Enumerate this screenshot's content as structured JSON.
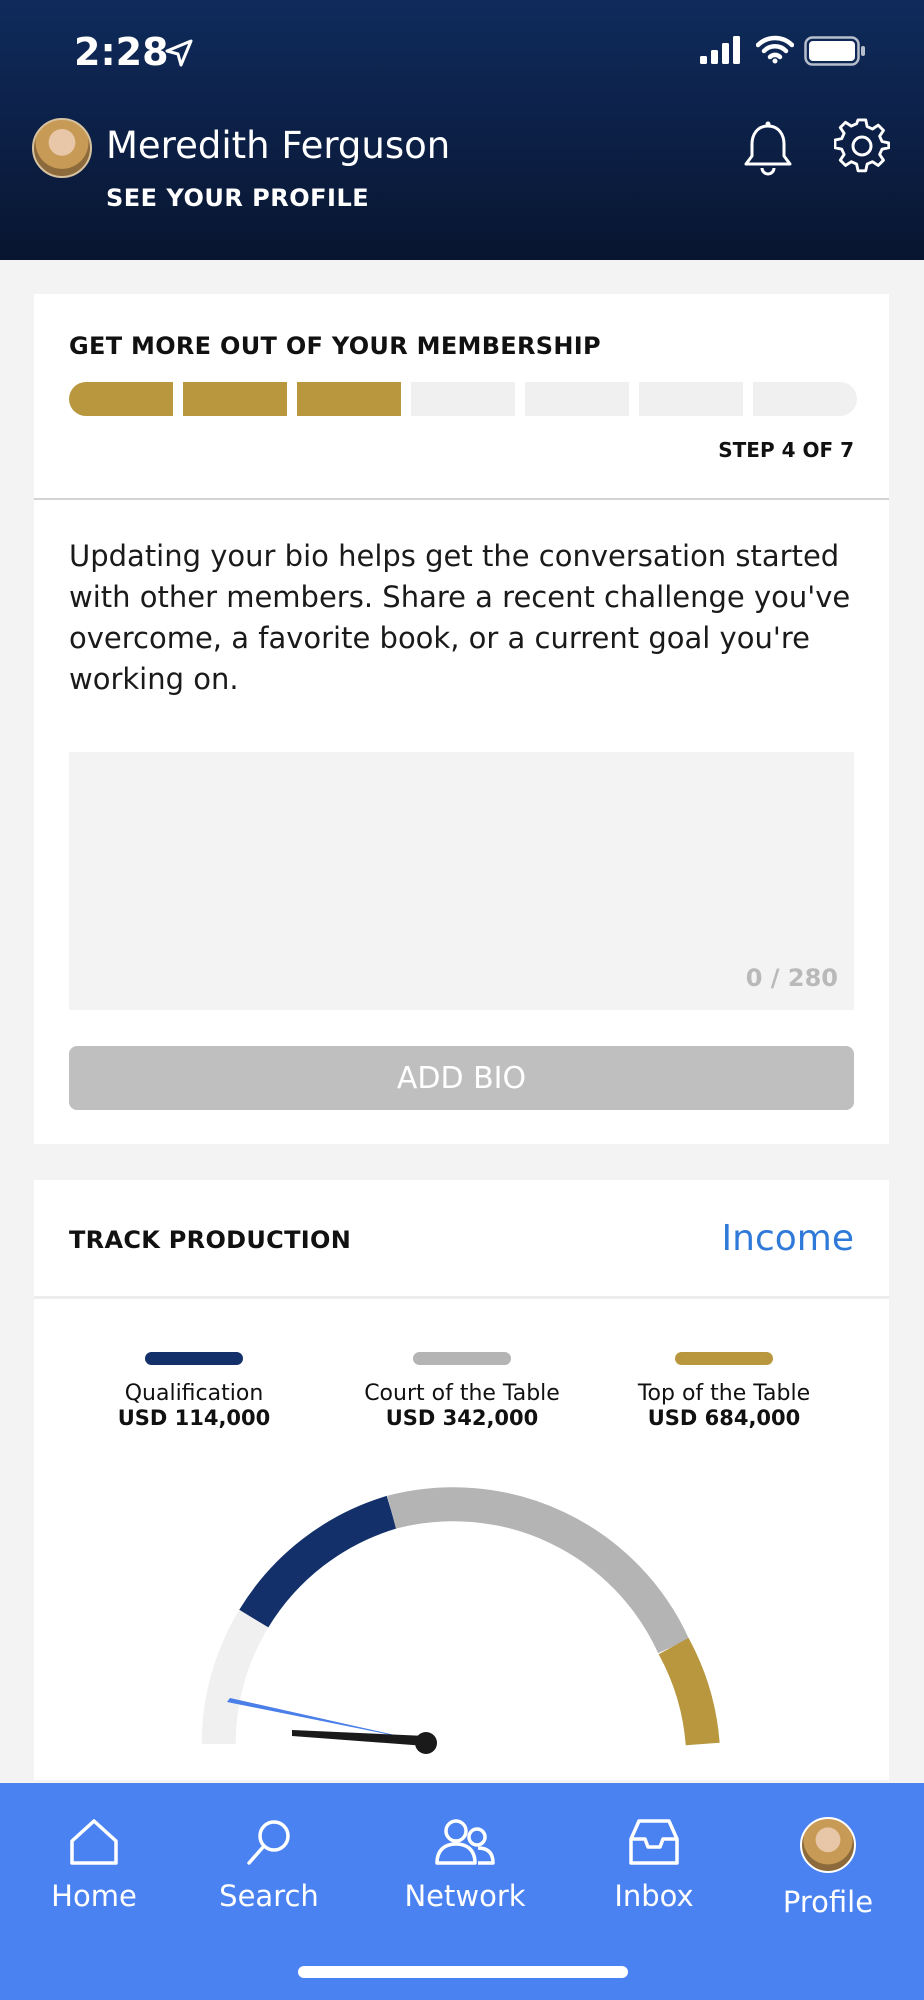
{
  "status_bar": {
    "time": "2:28",
    "location_icon": "location-arrow-icon",
    "signal_icon": "cell-signal-icon",
    "wifi_icon": "wifi-icon",
    "battery_icon": "battery-icon"
  },
  "header": {
    "name": "Meredith Ferguson",
    "profile_link": "SEE YOUR PROFILE",
    "notification_icon": "bell-icon",
    "settings_icon": "gear-icon"
  },
  "membership": {
    "title": "GET MORE OUT OF YOUR MEMBERSHIP",
    "step_label": "STEP 4 OF 7",
    "steps_completed": 3,
    "steps_total": 7,
    "progress_color": "#b8973f",
    "description": "Updating your bio helps get the conversation started with other members. Share a recent challenge you've overcome, a favorite book, or a current goal you're working on.",
    "bio_value": "",
    "char_count": "0 / 280",
    "add_button": "ADD BIO"
  },
  "track": {
    "title": "TRACK PRODUCTION",
    "link": "Income",
    "legend": [
      {
        "label": "Qualification",
        "value": "USD 114,000",
        "color": "#13306a"
      },
      {
        "label": "Court of the Table",
        "value": "USD 342,000",
        "color": "#b4b4b4"
      },
      {
        "label": "Top of the Table",
        "value": "USD 684,000",
        "color": "#b8973f"
      }
    ]
  },
  "tabbar": {
    "items": [
      {
        "label": "Home",
        "icon": "home-icon"
      },
      {
        "label": "Search",
        "icon": "search-icon"
      },
      {
        "label": "Network",
        "icon": "people-icon"
      },
      {
        "label": "Inbox",
        "icon": "inbox-icon"
      },
      {
        "label": "Profile",
        "icon": "avatar"
      }
    ],
    "background": "#4a82f2"
  }
}
